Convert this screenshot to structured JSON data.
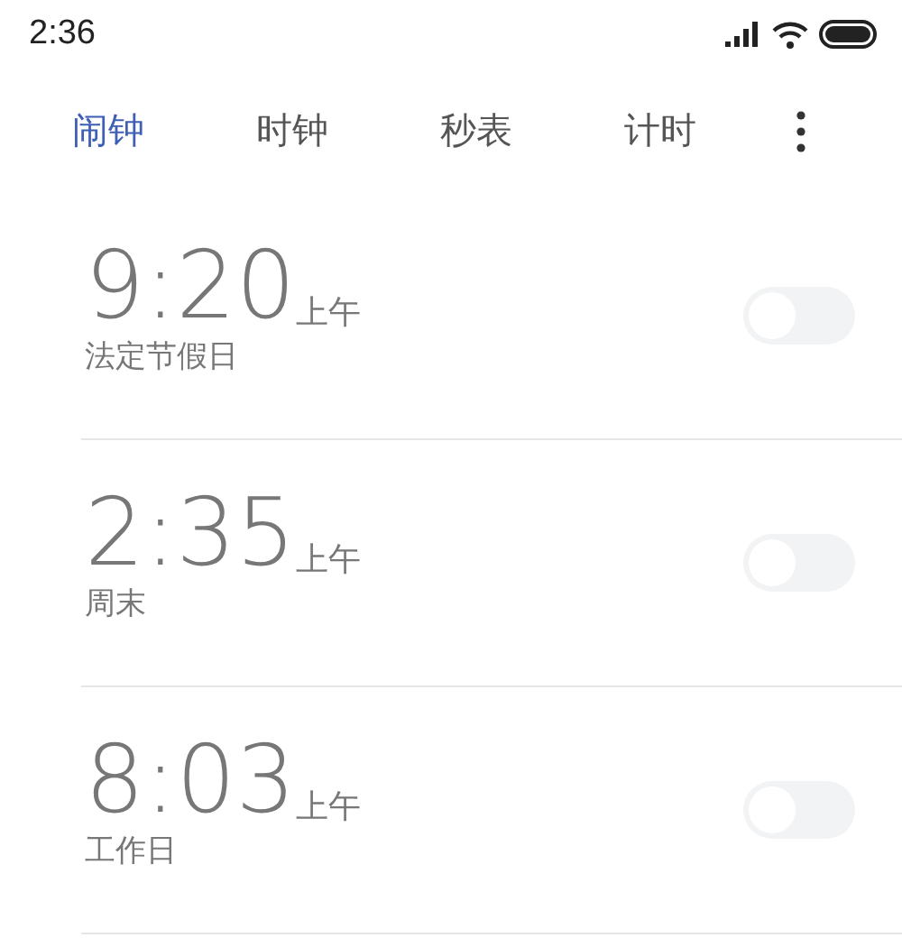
{
  "status_bar": {
    "time": "2:36"
  },
  "tabs": [
    {
      "label": "闹钟",
      "selected": true
    },
    {
      "label": "时钟",
      "selected": false
    },
    {
      "label": "秒表",
      "selected": false
    },
    {
      "label": "计时",
      "selected": false
    }
  ],
  "alarms": [
    {
      "time": "9:20",
      "period": "上午",
      "label": "法定节假日",
      "on": false
    },
    {
      "time": "2:35",
      "period": "上午",
      "label": "周末",
      "on": false
    },
    {
      "time": "8:03",
      "period": "上午",
      "label": "工作日",
      "on": false
    }
  ]
}
